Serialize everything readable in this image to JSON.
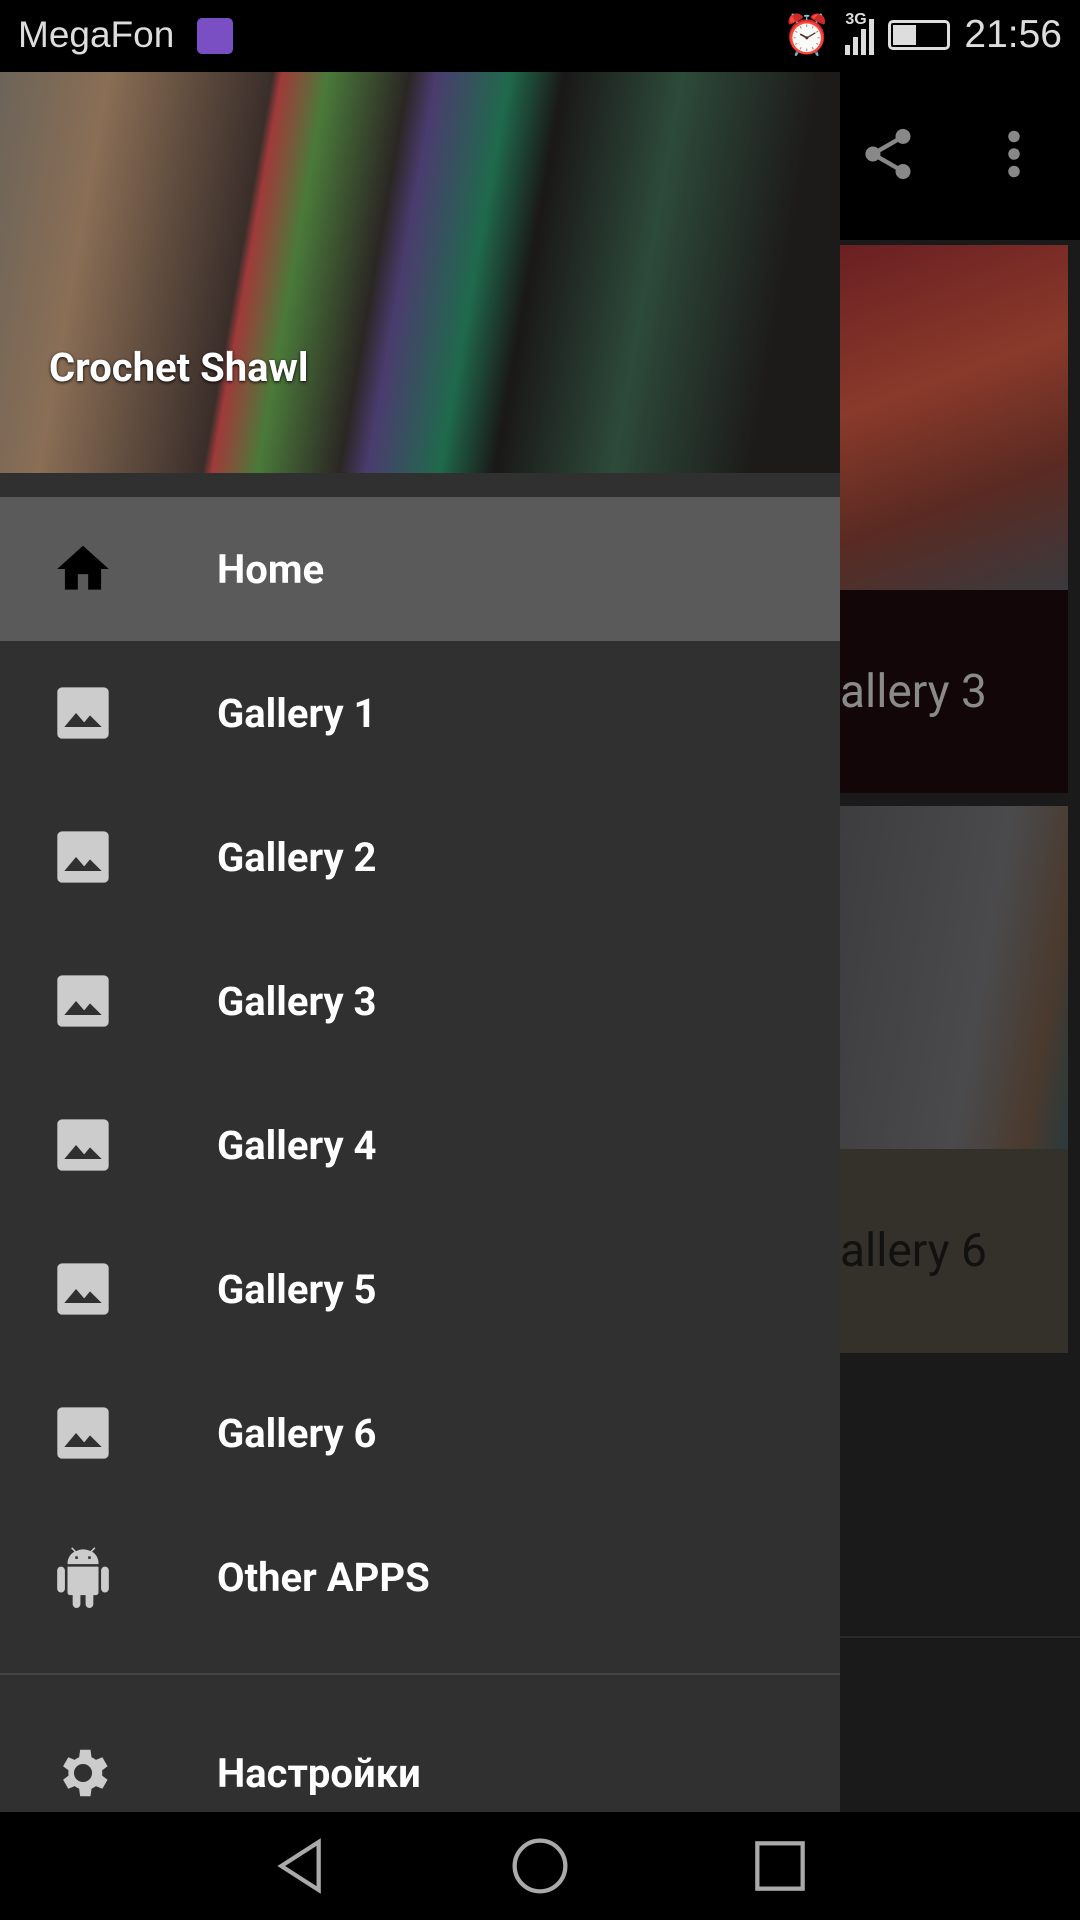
{
  "status_bar": {
    "carrier": "MegaFon",
    "network": "3G",
    "time": "21:56",
    "battery_level": 0.4
  },
  "app_bar": {
    "icons": [
      "share-icon",
      "more-vert-icon"
    ]
  },
  "content": {
    "cards": [
      {
        "label": "Gallery 3"
      },
      {
        "label": "Gallery 6"
      }
    ],
    "visible_fragments": [
      "allery 3",
      "allery 6"
    ]
  },
  "drawer": {
    "header_title": "Crochet Shawl",
    "items": [
      {
        "label": "Home",
        "icon": "home-icon",
        "active": true
      },
      {
        "label": "Gallery 1",
        "icon": "image-icon"
      },
      {
        "label": "Gallery 2",
        "icon": "image-icon"
      },
      {
        "label": "Gallery 3",
        "icon": "image-icon"
      },
      {
        "label": "Gallery 4",
        "icon": "image-icon"
      },
      {
        "label": "Gallery 5",
        "icon": "image-icon"
      },
      {
        "label": "Gallery 6",
        "icon": "image-icon"
      },
      {
        "label": "Other APPS",
        "icon": "android-icon"
      }
    ],
    "settings_label": "Настройки"
  },
  "colors": {
    "drawer_bg": "#303030",
    "active_row": "#5a5a5a"
  }
}
